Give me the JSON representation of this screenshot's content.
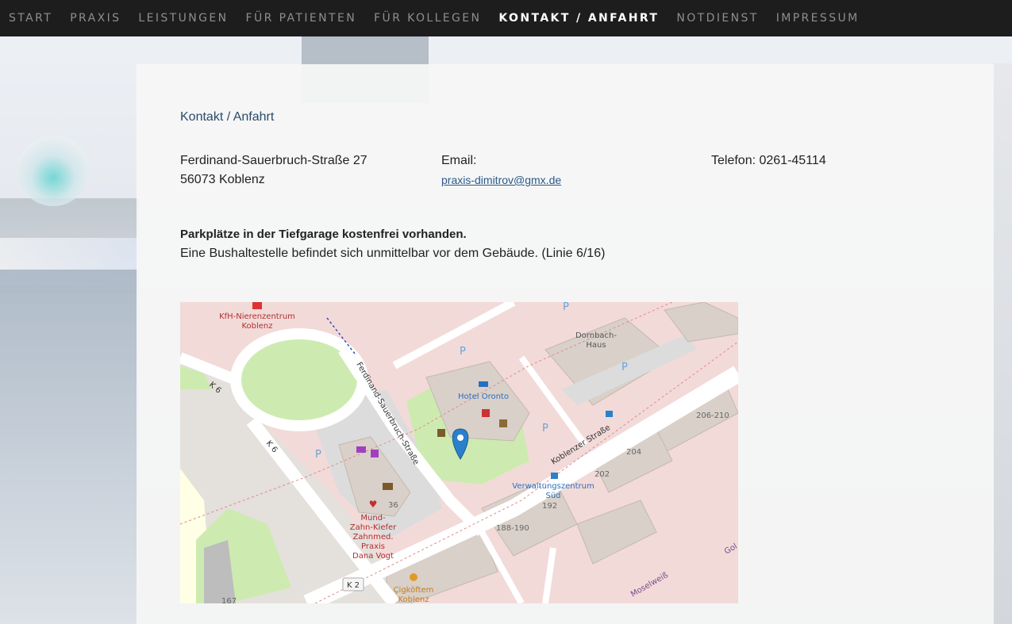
{
  "nav": {
    "items": [
      {
        "label": "START"
      },
      {
        "label": "PRAXIS"
      },
      {
        "label": "LEISTUNGEN"
      },
      {
        "label": "FÜR PATIENTEN"
      },
      {
        "label": "FÜR KOLLEGEN"
      },
      {
        "label": "KONTAKT / ANFAHRT",
        "active": true
      },
      {
        "label": "NOTDIENST"
      },
      {
        "label": "IMPRESSUM"
      }
    ]
  },
  "page": {
    "breadcrumb": "Kontakt / Anfahrt",
    "address": {
      "street": "Ferdinand-Sauerbruch-Straße 27",
      "city": "56073 Koblenz"
    },
    "email": {
      "label": "Email:",
      "address": "praxis-dimitrov@gmx.de"
    },
    "phone": "Telefon: 0261-45114",
    "parking": "Parkplätze in der Tiefgarage kostenfrei vorhanden.",
    "bus": "Eine Bushaltestelle befindet sich unmittelbar vor dem Gebäude. (Linie 6/16)"
  },
  "map": {
    "labels": {
      "kfh_1": "KfH-Nierenzentrum",
      "kfh_2": "Koblenz",
      "street_fs": "Ferdinand-Sauerbruch-Straße",
      "street_kobl": "Koblenzer Straße",
      "k6_a": "K 6",
      "k6_b": "K 6",
      "k2": "K 2",
      "hotel": "Hotel Oronto",
      "dornbach_1": "Dornbach-",
      "dornbach_2": "Haus",
      "verw_1": "Verwaltungszentrum",
      "verw_2": "Süd",
      "mund_1": "Mund-",
      "mund_2": "Zahn-Kiefer",
      "mund_3": "Zahnmed.",
      "mund_4": "Praxis",
      "mund_5": "Dana Vogt",
      "cig_1": "Çigköftem",
      "cig_2": "Koblenz",
      "moselweiss": "Moselweiß",
      "n36": "36",
      "n192": "192",
      "n202": "202",
      "n204": "204",
      "n206": "206-210",
      "n188": "188-190",
      "n167": "167",
      "gol": "Gol"
    },
    "colors": {
      "pin": "#2a81cb",
      "road": "#ffffff",
      "park": "#cdebb0",
      "building": "#d9d0c9",
      "residential": "#f2dad9"
    }
  }
}
